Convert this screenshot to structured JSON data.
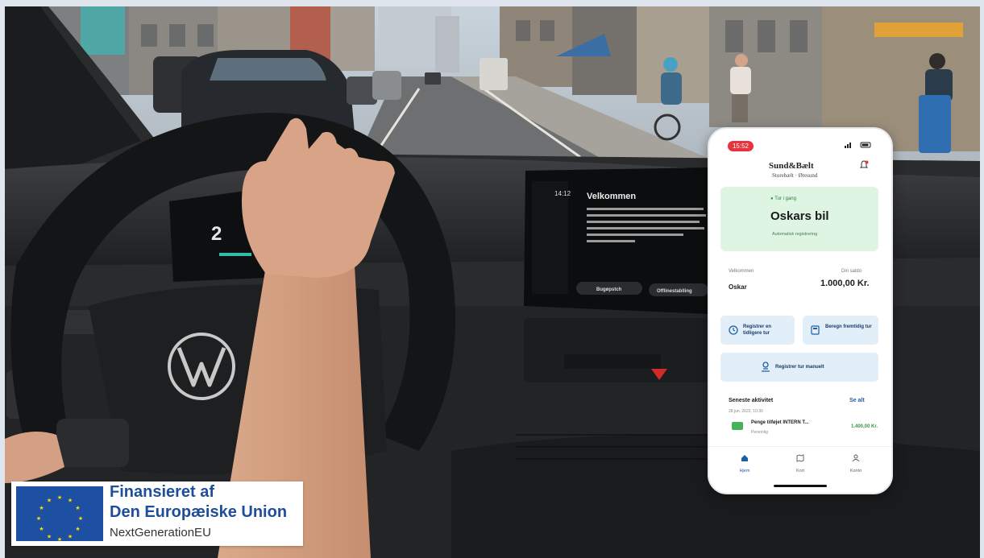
{
  "eu_badge": {
    "line1": "Finansieret af",
    "line2": "Den Europæiske Union",
    "line3": "NextGenerationEU"
  },
  "dashboard": {
    "title": "Velkommen",
    "time": "14:12",
    "button_left": "Bugøpstch",
    "button_right": "Offlinestablling"
  },
  "phone": {
    "status_time": "15:52",
    "logo_top": "Sund&Bælt",
    "logo_bottom": "Storebælt · Øresund",
    "trip_status": "Tur i gang",
    "car_name": "Oskars bil",
    "auto_registration": "Automatisk registrering",
    "welcome_label": "Velkommen",
    "user_name": "Oskar",
    "balance_label": "Din saldo",
    "balance": "1.000,00 Kr.",
    "buttons": {
      "register_past": "Registrer en tidligere tur",
      "calculate_future": "Beregn fremtidig tur",
      "register_manual": "Registrer tur manuelt"
    },
    "recent": {
      "title": "Seneste aktivitet",
      "see_all": "Se alt",
      "date": "28 jun. 2022, 10:30",
      "item_name": "Penge tilføjet  INTERN T...",
      "item_sub": "Personlig",
      "item_amount": "1.400,00 Kr."
    },
    "nav": {
      "home": "Hjem",
      "map": "Kort",
      "account": "Konto"
    }
  },
  "colors": {
    "eu_blue": "#1f4e99",
    "eu_flag": "#1d4fa3",
    "eu_star": "#ffdd00",
    "trip_card": "#dff5e3",
    "button_bg": "#e2eef8",
    "status_red": "#e8323c"
  }
}
